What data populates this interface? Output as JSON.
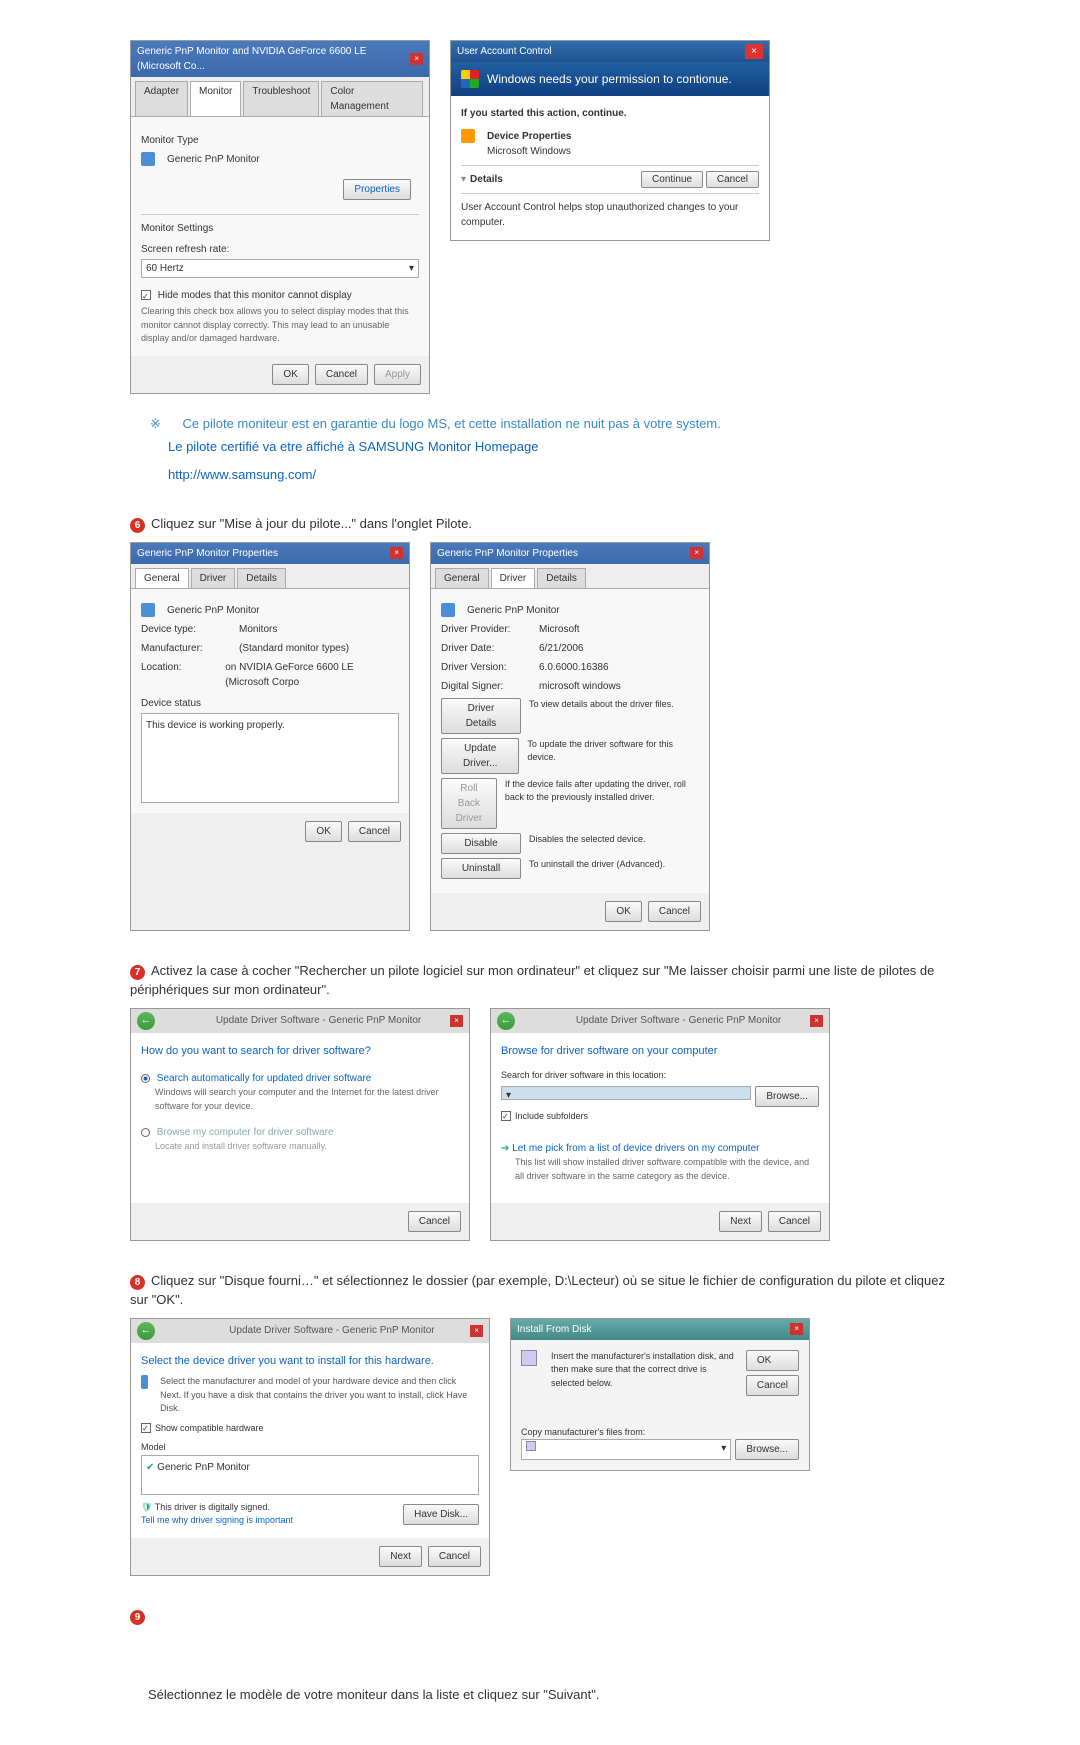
{
  "dlg1": {
    "title": "Generic PnP Monitor and NVIDIA GeForce 6600 LE (Microsoft Co...",
    "tabs": [
      "Adapter",
      "Monitor",
      "Troubleshoot",
      "Color Management"
    ],
    "monitor_type_label": "Monitor Type",
    "monitor_name": "Generic PnP Monitor",
    "properties_btn": "Properties",
    "settings_label": "Monitor Settings",
    "refresh_label": "Screen refresh rate:",
    "refresh_value": "60 Hertz",
    "hide_modes": "Hide modes that this monitor cannot display",
    "hide_desc": "Clearing this check box allows you to select display modes that this monitor cannot display correctly. This may lead to an unusable display and/or damaged hardware.",
    "ok": "OK",
    "cancel": "Cancel",
    "apply": "Apply"
  },
  "uac": {
    "title": "User Account Control",
    "headline": "Windows needs your permission to contionue.",
    "started": "If you started this action, continue.",
    "device_props": "Device Properties",
    "ms_windows": "Microsoft Windows",
    "details": "Details",
    "continue": "Continue",
    "cancel": "Cancel",
    "footer": "User Account Control helps stop unauthorized changes to your computer."
  },
  "note1": "Ce pilote moniteur est en garantie du logo MS, et cette installation ne nuit pas à votre system.",
  "note2": "Le pilote certifié va etre affiché à SAMSUNG Monitor Homepage",
  "samsung_url": "http://www.samsung.com/",
  "step6": "Cliquez sur \"Mise à jour du pilote...\" dans l'onglet Pilote.",
  "props1": {
    "title": "Generic PnP Monitor Properties",
    "tabs": [
      "General",
      "Driver",
      "Details"
    ],
    "name": "Generic PnP Monitor",
    "devtype_l": "Device type:",
    "devtype_v": "Monitors",
    "manuf_l": "Manufacturer:",
    "manuf_v": "(Standard monitor types)",
    "loc_l": "Location:",
    "loc_v": "on NVIDIA GeForce 6600 LE (Microsoft Corpo",
    "status_l": "Device status",
    "status_t": "This device is working properly.",
    "ok": "OK",
    "cancel": "Cancel"
  },
  "props2": {
    "title": "Generic PnP Monitor Properties",
    "tabs": [
      "General",
      "Driver",
      "Details"
    ],
    "name": "Generic PnP Monitor",
    "prov_l": "Driver Provider:",
    "prov_v": "Microsoft",
    "date_l": "Driver Date:",
    "date_v": "6/21/2006",
    "ver_l": "Driver Version:",
    "ver_v": "6.0.6000.16386",
    "sign_l": "Digital Signer:",
    "sign_v": "microsoft windows",
    "b1": "Driver Details",
    "b1d": "To view details about the driver files.",
    "b2": "Update Driver...",
    "b2d": "To update the driver software for this device.",
    "b3": "Roll Back Driver",
    "b3d": "If the device fails after updating the driver, roll back to the previously installed driver.",
    "b4": "Disable",
    "b4d": "Disables the selected device.",
    "b5": "Uninstall",
    "b5d": "To uninstall the driver (Advanced).",
    "ok": "OK",
    "cancel": "Cancel"
  },
  "step7": "Activez la case à cocher \"Rechercher un pilote logiciel sur mon ordinateur\" et cliquez sur \"Me laisser choisir parmi une liste de pilotes de périphériques sur mon ordinateur\".",
  "wiz1": {
    "crumb": "Update Driver Software - Generic PnP Monitor",
    "heading": "How do you want to search for driver software?",
    "opt1_t": "Search automatically for updated driver software",
    "opt1_d": "Windows will search your computer and the Internet for the latest driver software for your device.",
    "opt2_t": "Browse my computer for driver software",
    "opt2_d": "Locate and install driver software manually.",
    "cancel": "Cancel"
  },
  "wiz2": {
    "crumb": "Update Driver Software - Generic PnP Monitor",
    "heading": "Browse for driver software on your computer",
    "search_label": "Search for driver software in this location:",
    "browse": "Browse...",
    "include": "Include subfolders",
    "opt_t": "Let me pick from a list of device drivers on my computer",
    "opt_d": "This list will show installed driver software compatible with the device, and all driver software in the same category as the device.",
    "next": "Next",
    "cancel": "Cancel"
  },
  "step8": "Cliquez sur \"Disque fourni…\" et sélectionnez le dossier (par exemple, D:\\Lecteur) où se situe le fichier de configuration du pilote et cliquez sur \"OK\".",
  "wiz3": {
    "crumb": "Update Driver Software - Generic PnP Monitor",
    "heading": "Select the device driver you want to install for this hardware.",
    "desc": "Select the manufacturer and model of your hardware device and then click Next. If you have a disk that contains the driver you want to install, click Have Disk.",
    "show_compat": "Show compatible hardware",
    "model": "Model",
    "item": "Generic PnP Monitor",
    "signed": "This driver is digitally signed.",
    "why": "Tell me why driver signing is important",
    "have_disk": "Have Disk...",
    "next": "Next",
    "cancel": "Cancel"
  },
  "ifd": {
    "title": "Install From Disk",
    "msg": "Insert the manufacturer's installation disk, and then make sure that the correct drive is selected below.",
    "ok": "OK",
    "cancel": "Cancel",
    "copy": "Copy manufacturer's files from:",
    "browse": "Browse..."
  },
  "step9": "Sélectionnez le modèle de votre moniteur dans la liste et cliquez sur \"Suivant\".",
  "bullets": {
    "b6": "6",
    "b7": "7",
    "b8": "8",
    "b9": "9"
  }
}
